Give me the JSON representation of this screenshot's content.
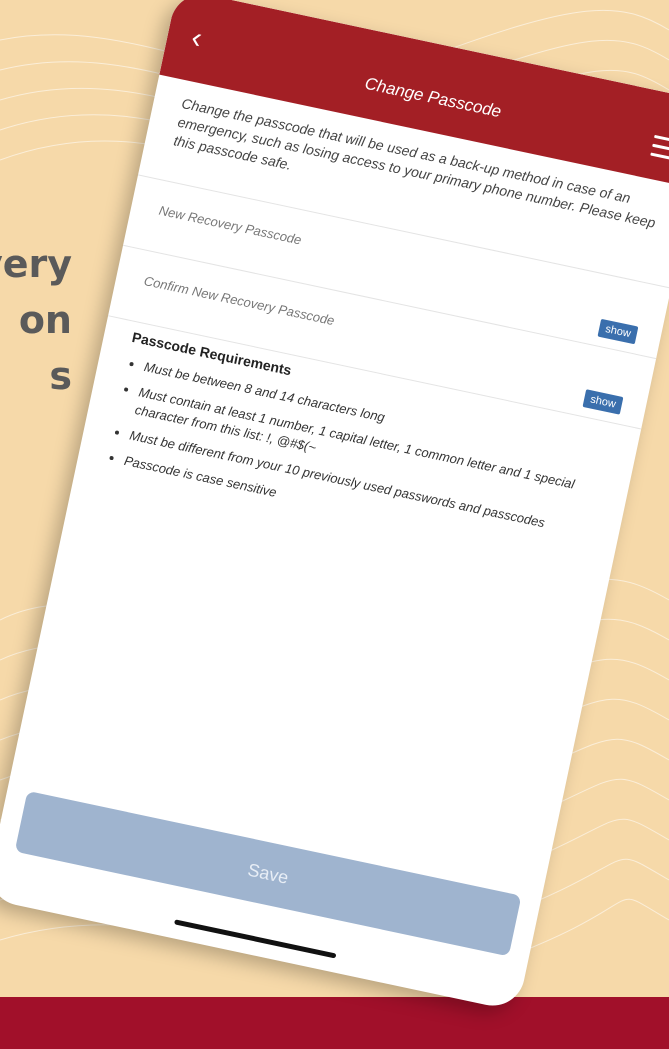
{
  "background": {
    "text_lines": [
      "very",
      "on",
      "s"
    ],
    "accent_color": "#a1102a",
    "base_color": "#f6d9a9"
  },
  "header": {
    "title": "Change Passcode",
    "color": "#a31f25"
  },
  "intro": "Change the passcode that will be used as a back-up method in case of an emergency, such as losing access to your primary phone number. Please keep this passcode safe.",
  "fields": [
    {
      "label": "New Recovery Passcode",
      "show_label": "show"
    },
    {
      "label": "Confirm New Recovery Passcode",
      "show_label": "show"
    }
  ],
  "requirements": {
    "title": "Passcode Requirements",
    "items": [
      "Must be between 8 and 14 characters long",
      "Must contain at least 1 number, 1 capital letter, 1 common letter and 1 special character from this list: !, @#$(~",
      "Must be different from your 10 previously used passwords and passcodes",
      "Passcode is case sensitive"
    ]
  },
  "save_label": "Save"
}
